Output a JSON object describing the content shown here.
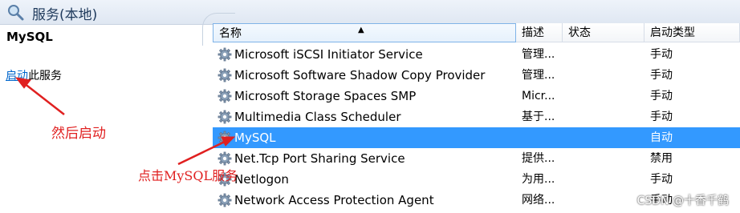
{
  "window": {
    "title": "服务(本地)",
    "title_icon": "search-services-icon"
  },
  "left_pane": {
    "service_name": "MySQL",
    "start_link": "启动",
    "start_suffix": "此服务"
  },
  "table": {
    "columns": [
      "名称",
      "描述",
      "状态",
      "启动类型"
    ],
    "rows": [
      {
        "name": "Microsoft iSCSI Initiator Service",
        "desc": "管理...",
        "status": "",
        "startup": "手动"
      },
      {
        "name": "Microsoft Software Shadow Copy Provider",
        "desc": "管理...",
        "status": "",
        "startup": "手动"
      },
      {
        "name": "Microsoft Storage Spaces SMP",
        "desc": "Micr...",
        "status": "",
        "startup": "手动"
      },
      {
        "name": "Multimedia Class Scheduler",
        "desc": "基于...",
        "status": "",
        "startup": "手动"
      },
      {
        "name": "MySQL",
        "desc": "",
        "status": "",
        "startup": "自动"
      },
      {
        "name": "Net.Tcp Port Sharing Service",
        "desc": "提供...",
        "status": "",
        "startup": "禁用"
      },
      {
        "name": "Netlogon",
        "desc": "为用...",
        "status": "",
        "startup": "手动"
      },
      {
        "name": "Network Access Protection Agent",
        "desc": "网络...",
        "status": "",
        "startup": "手动"
      }
    ],
    "selected_index": 4
  },
  "annotations": {
    "step1": "然后启动",
    "step2": "点击MySQL服务"
  },
  "watermark": "CSDN @十香千鹤",
  "colors": {
    "selection": "#3399ff",
    "annotation": "#e02020",
    "link": "#0066cc"
  }
}
